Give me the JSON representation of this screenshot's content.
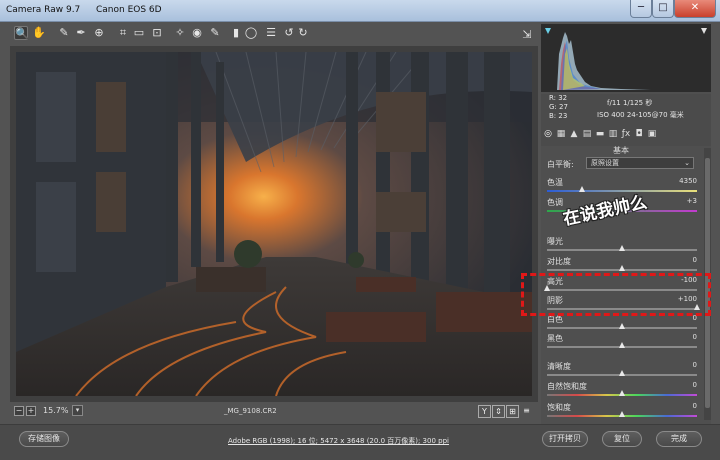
{
  "window": {
    "title": "Camera Raw 9.7",
    "camera": "Canon EOS 6D",
    "minimize": "─",
    "maximize": "□",
    "close": "✕"
  },
  "toolbar": {
    "tools": [
      {
        "name": "zoom-tool",
        "glyph": "🔍"
      },
      {
        "name": "hand-tool",
        "glyph": "✋"
      },
      {
        "name": "white-balance-tool",
        "glyph": "✎"
      },
      {
        "name": "color-sampler-tool",
        "glyph": "✒"
      },
      {
        "name": "targeted-adjustment-tool",
        "glyph": "⊕"
      },
      {
        "name": "crop-tool",
        "glyph": "⌗"
      },
      {
        "name": "straighten-tool",
        "glyph": "▭"
      },
      {
        "name": "transform-tool",
        "glyph": "⊡"
      },
      {
        "name": "spot-removal-tool",
        "glyph": "✧"
      },
      {
        "name": "red-eye-tool",
        "glyph": "◉"
      },
      {
        "name": "adjustment-brush-tool",
        "glyph": "✎"
      },
      {
        "name": "graduated-filter-tool",
        "glyph": "▮"
      },
      {
        "name": "radial-filter-tool",
        "glyph": "◯"
      },
      {
        "name": "preferences-tool",
        "glyph": "☰"
      },
      {
        "name": "rotate-left-tool",
        "glyph": "↺"
      },
      {
        "name": "rotate-right-tool",
        "glyph": "↻"
      }
    ],
    "export_glyph": "⇲"
  },
  "status": {
    "zoom_out": "−",
    "zoom_in": "+",
    "zoom": "15.7%",
    "zoom_dropdown": "▾",
    "filename": "_MG_9108.CR2",
    "view_buttons": [
      "Y",
      "⇕",
      "⊞",
      "≡"
    ]
  },
  "bottom": {
    "save_label": "存储图像",
    "workflow_link": "Adobe RGB (1998); 16 位; 5472 x 3648 (20.0 百万像素); 300 ppi",
    "open_label": "打开拷贝",
    "reset_label": "复位",
    "done_label": "完成"
  },
  "readout": {
    "r": "R:  32",
    "g": "G:  27",
    "b": "B:  23",
    "exposure": "f/11   1/125 秒",
    "lens": "ISO 400   24-105@70 毫米"
  },
  "panel": {
    "title": "基本",
    "tabs": [
      "◎",
      "▦",
      "▲",
      "▤",
      "▬",
      "▥",
      "ƒx",
      "◘",
      "▣"
    ],
    "wb_label": "白平衡:",
    "wb_value": "原照设置",
    "wb_chevron": "⌄",
    "sliders": [
      {
        "label": "色温",
        "value": "4350",
        "pos": 0.23
      },
      {
        "label": "色调",
        "value": "+3",
        "pos": 0.51
      },
      {
        "label": "曝光",
        "value": "",
        "pos": 0.5
      },
      {
        "label": "对比度",
        "value": "0",
        "pos": 0.5
      },
      {
        "label": "高光",
        "value": "-100",
        "pos": 0.0
      },
      {
        "label": "阴影",
        "value": "+100",
        "pos": 1.0
      },
      {
        "label": "白色",
        "value": "0",
        "pos": 0.5
      },
      {
        "label": "黑色",
        "value": "0",
        "pos": 0.5
      },
      {
        "label": "清晰度",
        "value": "0",
        "pos": 0.5
      },
      {
        "label": "自然饱和度",
        "value": "0",
        "pos": 0.5
      },
      {
        "label": "饱和度",
        "value": "0",
        "pos": 0.5
      }
    ]
  },
  "annotation": {
    "text": "在说我帅么",
    "color": "#e01818"
  }
}
